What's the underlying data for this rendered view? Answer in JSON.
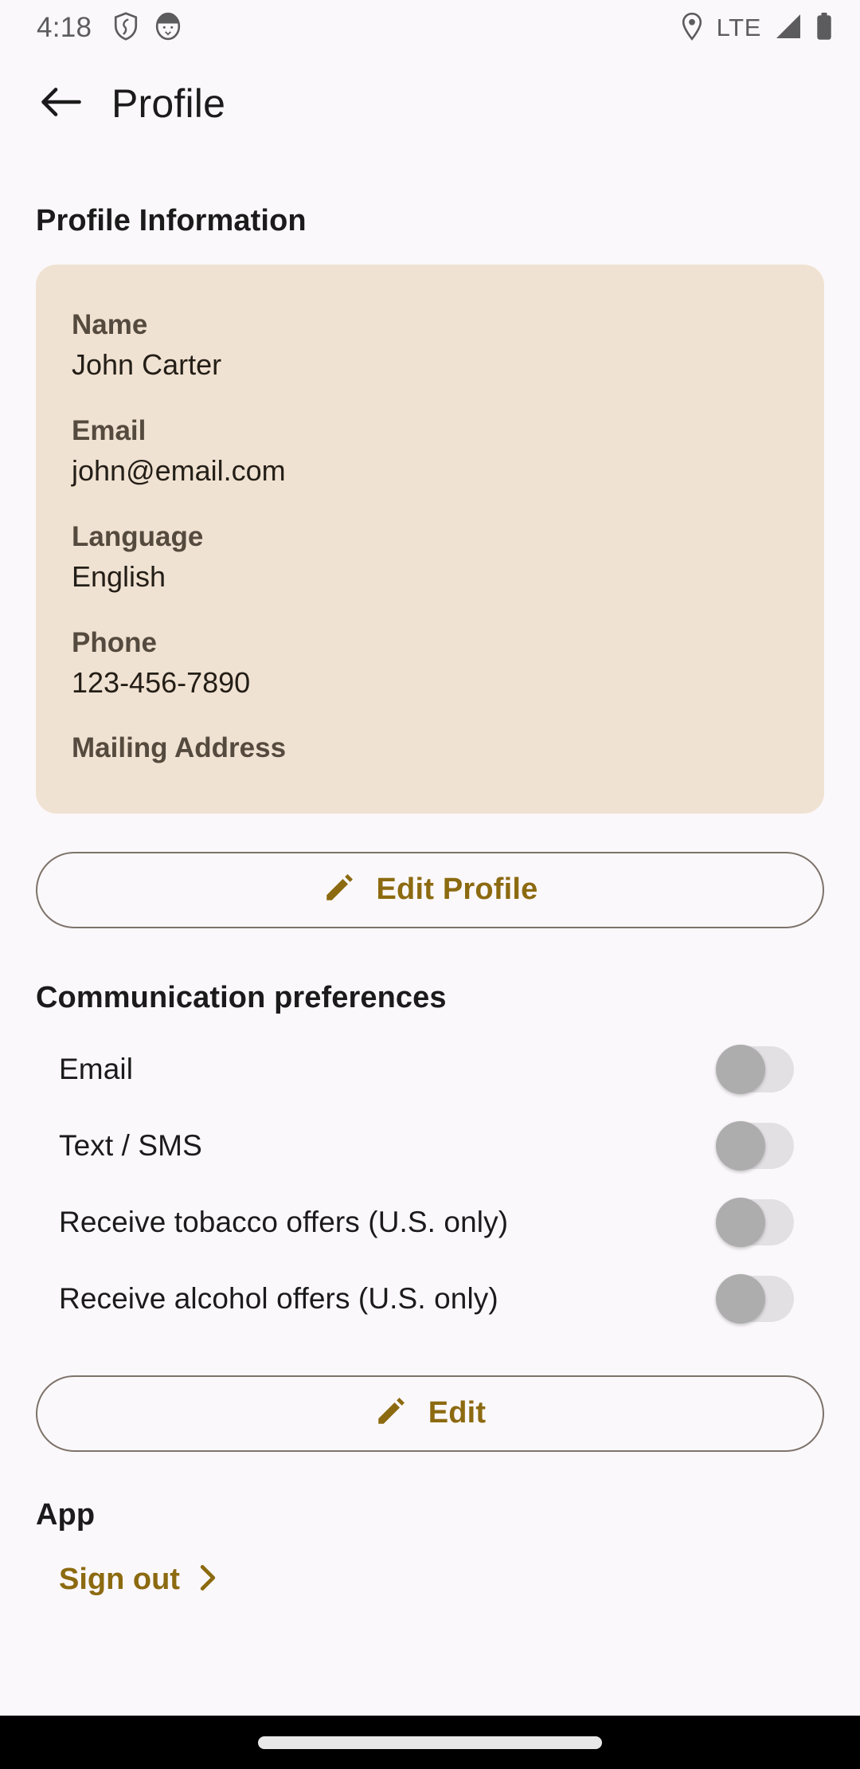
{
  "status_bar": {
    "time": "4:18",
    "network_label": "LTE",
    "icons": [
      "shield-icon",
      "ghost-icon",
      "location-pin-icon",
      "signal-icon",
      "battery-icon"
    ]
  },
  "app_bar": {
    "back_icon": "arrow-left-icon",
    "title": "Profile"
  },
  "profile_information": {
    "section_title": "Profile Information",
    "fields": [
      {
        "label": "Name",
        "value": "John Carter"
      },
      {
        "label": "Email",
        "value": "john@email.com"
      },
      {
        "label": "Language",
        "value": "English"
      },
      {
        "label": "Phone",
        "value": "123-456-7890"
      },
      {
        "label": "Mailing Address",
        "value": ""
      }
    ],
    "edit_button": {
      "label": "Edit Profile",
      "icon": "pencil-icon"
    }
  },
  "communication_preferences": {
    "section_title": "Communication preferences",
    "items": [
      {
        "label": "Email",
        "enabled": false
      },
      {
        "label": "Text / SMS",
        "enabled": false
      },
      {
        "label": "Receive tobacco offers (U.S. only)",
        "enabled": false
      },
      {
        "label": "Receive alcohol offers (U.S. only)",
        "enabled": false
      }
    ],
    "edit_button": {
      "label": "Edit",
      "icon": "pencil-icon"
    }
  },
  "app_section": {
    "section_title": "App",
    "sign_out": {
      "label": "Sign out",
      "icon": "chevron-right-icon"
    }
  },
  "colors": {
    "page_background": "#FBF8FB",
    "card_background": "#F0E2D2",
    "accent_gold": "#8C6A10",
    "primary_text": "#1B1B1B",
    "label_text": "#554A3E",
    "outline": "#7D736A",
    "switch_track_off": "#E3E0E4",
    "switch_thumb_off": "#ADADAD",
    "nav_bar": "#000000"
  }
}
